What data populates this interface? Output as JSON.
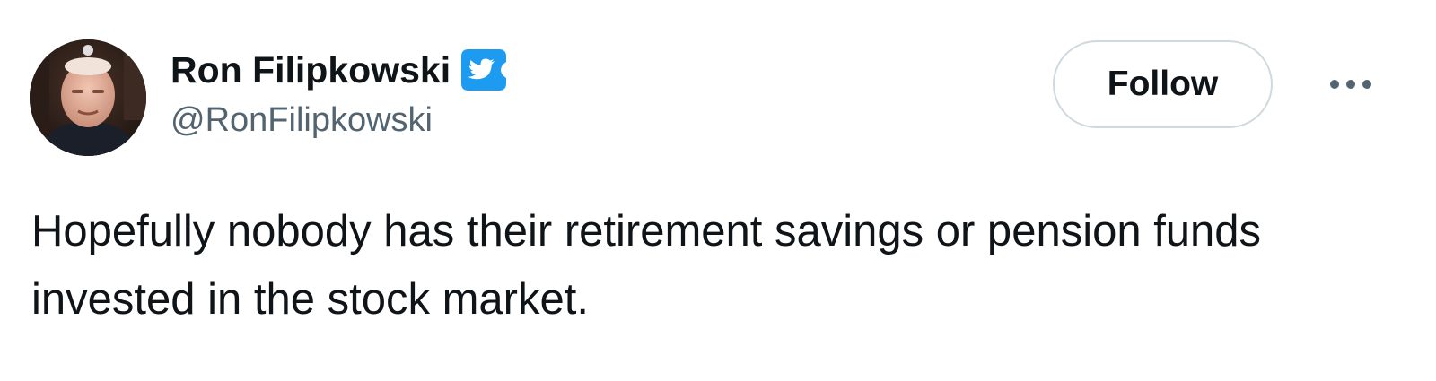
{
  "author": {
    "display_name": "Ron Filipkowski",
    "handle": "@RonFilipkowski",
    "avatar_icon": "profile-photo",
    "verified_icon": "twitter-bird-verified-icon",
    "badge_color": "#1d9bf0"
  },
  "actions": {
    "follow_label": "Follow",
    "more_icon": "more-dots-icon"
  },
  "tweet": {
    "text": "Hopefully nobody has their retirement savings or pension funds invested in the stock market."
  },
  "colors": {
    "text_primary": "#0f1419",
    "text_secondary": "#536471",
    "button_border": "#cfd9de"
  }
}
